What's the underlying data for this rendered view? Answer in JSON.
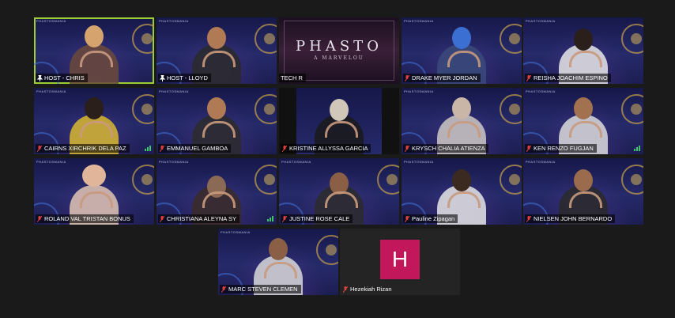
{
  "brand_text": "PHASTOSMANIA",
  "share": {
    "logo": "PHASTO",
    "tagline": "A MARVELOU",
    "label": "TECH R"
  },
  "participants": [
    {
      "name": "HOST - CHRIS",
      "muted": false
    },
    {
      "name": "HOST - LLOYD",
      "muted": false
    },
    {
      "name": "TECH R",
      "muted": true
    },
    {
      "name": "DRAKE MYER JORDAN",
      "muted": true
    },
    {
      "name": "REISHA JOACHIM ESPINO",
      "muted": true
    },
    {
      "name": "CAIRNS XIRCHRIK DELA PAZ",
      "muted": true
    },
    {
      "name": "EMMANUEL GAMBOA",
      "muted": true
    },
    {
      "name": "KRISTINE ALLYSSA GARCIA",
      "muted": true
    },
    {
      "name": "KRYSCH CHALIA ATIENZA",
      "muted": true
    },
    {
      "name": "KEN RENZO FUGJAN",
      "muted": true
    },
    {
      "name": "ROLAND VAL TRISTAN BONUS",
      "muted": true
    },
    {
      "name": "CHRISTIANA ALEYNA SY",
      "muted": true
    },
    {
      "name": "JUSTINE ROSE CALE",
      "muted": true
    },
    {
      "name": "Pauline Zipagan",
      "muted": true
    },
    {
      "name": "NIELSEN JOHN BERNARDO",
      "muted": true
    },
    {
      "name": "MARC STEVEN CLEMEN",
      "muted": true
    },
    {
      "name": "Hezekiah Rizan",
      "muted": true,
      "initial": "H"
    }
  ],
  "colors": {
    "active_speaker": "#9ccd33",
    "muted_icon": "#e0413c",
    "avatar_bg": "#c2185b"
  }
}
